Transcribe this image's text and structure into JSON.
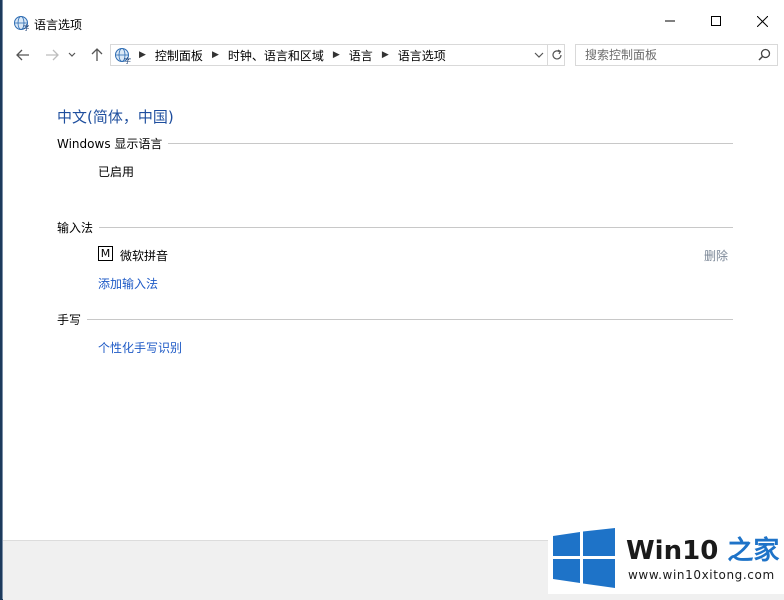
{
  "window": {
    "title": "语言选项"
  },
  "address": {
    "crumbs": [
      "控制面板",
      "时钟、语言和区域",
      "语言",
      "语言选项"
    ]
  },
  "search": {
    "placeholder": "搜索控制面板"
  },
  "content": {
    "language_name": "中文(简体，中国)",
    "display_section": "Windows 显示语言",
    "display_status": "已启用",
    "input_section": "输入法",
    "ime_icon_letter": "M",
    "ime_name": "微软拼音",
    "remove_label": "删除",
    "add_ime_label": "添加输入法",
    "handwriting_section": "手写",
    "handwriting_link": "个性化手写识别"
  },
  "watermark": {
    "brand_prefix": "Win10",
    "brand_suffix": "之家",
    "url": "www.win10xitong.com"
  },
  "colors": {
    "accent": "#1e4e9e",
    "link": "#1e5ac6",
    "watermark_blue": "#1e73c8"
  }
}
